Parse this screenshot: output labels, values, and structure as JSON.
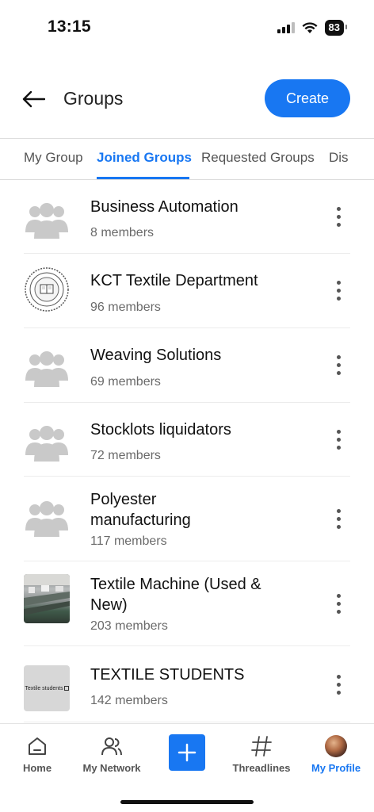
{
  "status_bar": {
    "time": "13:15",
    "battery": "83"
  },
  "header": {
    "title": "Groups",
    "create_label": "Create"
  },
  "tabs": [
    {
      "label": "My Group"
    },
    {
      "label": "Joined Groups"
    },
    {
      "label": "Requested Groups"
    },
    {
      "label": "Dis"
    }
  ],
  "groups": [
    {
      "name": "Business Automation",
      "members": "8 members",
      "avatar": "group-placeholder-icon"
    },
    {
      "name": "KCT Textile Department",
      "members": "96 members",
      "avatar": "college-seal"
    },
    {
      "name": "Weaving Solutions",
      "members": "69 members",
      "avatar": "group-placeholder-icon"
    },
    {
      "name": "Stocklots liquidators",
      "members": "72 members",
      "avatar": "group-placeholder-icon"
    },
    {
      "name": "Polyester manufacturing",
      "members": "117 members",
      "avatar": "group-placeholder-icon"
    },
    {
      "name": "Textile Machine (Used & New)",
      "members": "203 members",
      "avatar": "machine-photo"
    },
    {
      "name": "TEXTILE STUDENTS",
      "members": "142 members",
      "avatar": "text-image",
      "avatar_text": "Textile students"
    }
  ],
  "bottom_nav": {
    "home": "Home",
    "network": "My Network",
    "threadlines": "Threadlines",
    "profile": "My Profile"
  },
  "colors": {
    "accent": "#1877f2",
    "placeholder_gray": "#c9c9c9"
  }
}
